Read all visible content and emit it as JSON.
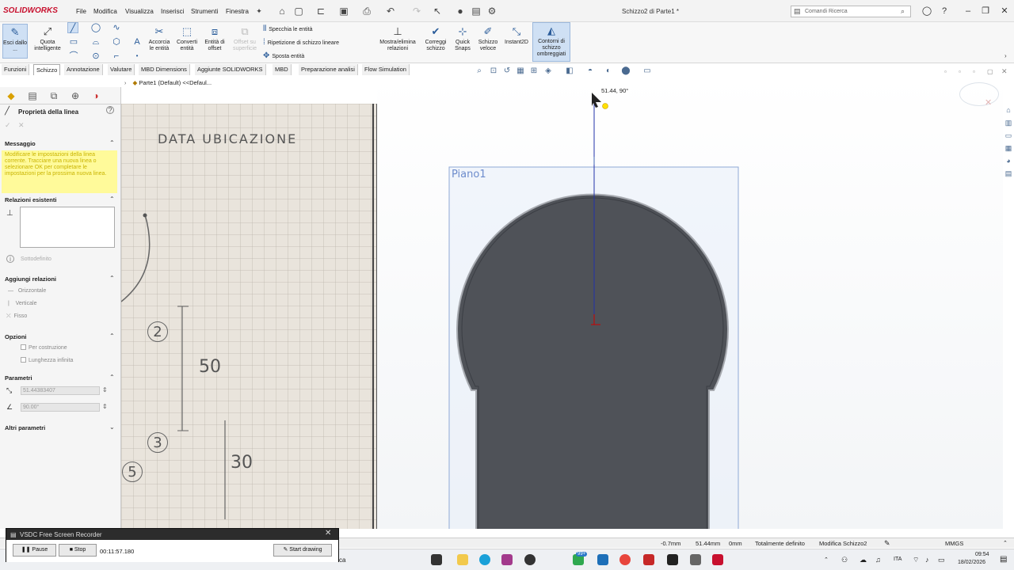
{
  "app": {
    "logo": "SOLIDWORKS",
    "document_title": "Schizzo2 di Parte1 *",
    "menu": [
      "File",
      "Modifica",
      "Visualizza",
      "Inserisci",
      "Strumenti",
      "Finestra"
    ],
    "search_placeholder": "Comandi Ricerca"
  },
  "ribbon": {
    "exit_sketch": "Esci dallo ...",
    "smart_dimension": "Quota intelligente",
    "trim": "Accorcia le entità",
    "convert": "Converti entità",
    "offset": "Entità di offset",
    "offset_surface": "Offset su superficie",
    "mirror": "Specchia le entità",
    "linear_pattern": "Ripetizione di schizzo lineare",
    "move": "Sposta entità",
    "show_relations": "Mostra/elimina relazioni",
    "repair": "Correggi schizzo",
    "quick_snaps": "Quick Snaps",
    "rapid_sketch": "Schizzo veloce",
    "instant2d": "Instant2D",
    "shaded_contours": "Contorni di schizzo ombreggiati"
  },
  "tabs": [
    "Funzioni",
    "Schizzo",
    "Annotazione",
    "Valutare",
    "MBD Dimensions",
    "Aggiunte SOLIDWORKS",
    "MBD",
    "Preparazione analisi",
    "Flow Simulation"
  ],
  "active_tab": "Schizzo",
  "tree": {
    "item": "Parte1 (Default) <<Defaul..."
  },
  "property_manager": {
    "title": "Proprietà della linea",
    "sections": {
      "message": "Messaggio",
      "message_text": "Modificare le impostazioni della linea corrente. Tracciare una nuova linea o selezionare OK per completare le impostazioni per la prossima nuova linea.",
      "existing_relations": "Relazioni esistenti",
      "underdefined": "Sottodefinito",
      "add_relations": "Aggiungi relazioni",
      "horizontal": "Orizzontale",
      "vertical": "Verticale",
      "fixed": "Fisso",
      "options": "Opzioni",
      "for_construction": "Per costruzione",
      "infinite_length": "Lunghezza infinita",
      "parameters": "Parametri",
      "length_value": "51.44383407",
      "angle_value": "90.00°",
      "more_parameters": "Altri parametri"
    }
  },
  "photo": {
    "header_text": "DATA UBICAZIONE",
    "circled": [
      "2",
      "3",
      "5"
    ],
    "dims": [
      "50",
      "30"
    ]
  },
  "graphics": {
    "plane_label": "Piano1",
    "cursor_readout": "51.44, 90°"
  },
  "statusbar": {
    "x": "-0.7mm",
    "y": "51.44mm",
    "z": "0mm",
    "state": "Totalmente definito",
    "mode": "Modifica Schizzo2",
    "units": "MMGS"
  },
  "recorder": {
    "title": "VSDC Free Screen Recorder",
    "pause": "Pause",
    "stop": "Stop",
    "time": "00:11:57.180",
    "start_drawing": "Start drawing"
  },
  "taskbar": {
    "search_fragment": "ca",
    "lang": "ITA",
    "time": "09:54",
    "date": "18/02/2026",
    "badge": "99+"
  }
}
